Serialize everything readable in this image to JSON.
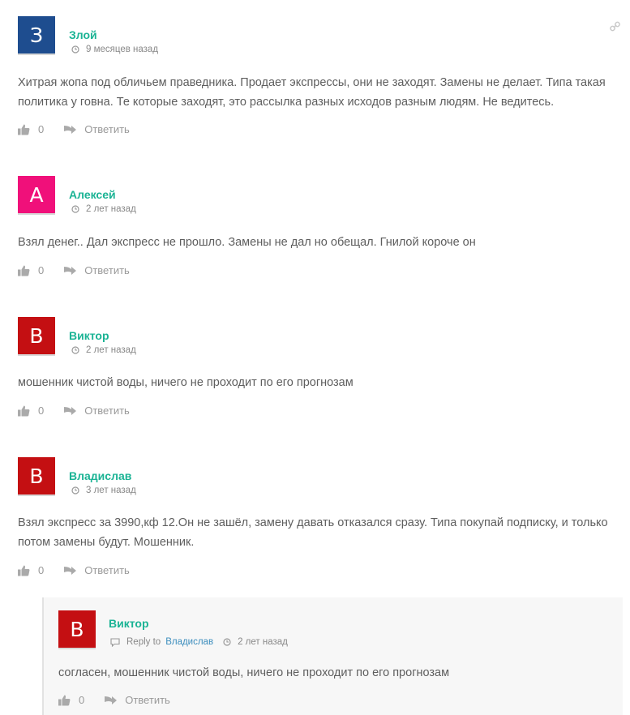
{
  "colors": {
    "author": "#1ab394",
    "avatar_blue": "#1e4d8f",
    "avatar_pink": "#f0107a",
    "avatar_red": "#c40f12",
    "reply_link": "#3b8dbd"
  },
  "comments": [
    {
      "avatar_letter": "З",
      "avatar_color": "#1e4d8f",
      "author": "Злой",
      "time": "9 месяцев назад",
      "text": "Хитрая жопа под обличьем праведника. Продает экспрессы, они не заходят. Замены не делает. Типа такая политика у говна. Те которые заходят, это рассылка разных исходов разным людям. Не ведитесь.",
      "likes": "0",
      "reply_label": "Ответить"
    },
    {
      "avatar_letter": "А",
      "avatar_color": "#f0107a",
      "author": "Алексей",
      "time": "2 лет назад",
      "text": "Взял денег.. Дал экспресс не прошло. Замены не дал но обещал. Гнилой короче он",
      "likes": "0",
      "reply_label": "Ответить"
    },
    {
      "avatar_letter": "В",
      "avatar_color": "#c40f12",
      "author": "Виктор",
      "time": "2 лет назад",
      "text": "мошенник чистой воды, ничего не проходит по его прогнозам",
      "likes": "0",
      "reply_label": "Ответить"
    },
    {
      "avatar_letter": "В",
      "avatar_color": "#c40f12",
      "author": "Владислав",
      "time": "3 лет назад",
      "text": "Взял экспресс за 3990,кф 12.Он не зашёл, замену давать отказался сразу. Типа покупай подписку, и только потом замены будут. Мошенник.",
      "likes": "0",
      "reply_label": "Ответить"
    }
  ],
  "reply": {
    "avatar_letter": "В",
    "avatar_color": "#c40f12",
    "author": "Виктор",
    "reply_to_label": "Reply to",
    "reply_to_name": "Владислав",
    "time": "2 лет назад",
    "text": "согласен, мошенник чистой воды, ничего не проходит по его прогнозам",
    "likes": "0",
    "reply_label": "Ответить"
  },
  "icons": {
    "clock": "clock-icon",
    "thumb": "thumbs-up-icon",
    "reply": "reply-arrow-icon",
    "link": "link-icon",
    "comment": "comment-icon"
  }
}
